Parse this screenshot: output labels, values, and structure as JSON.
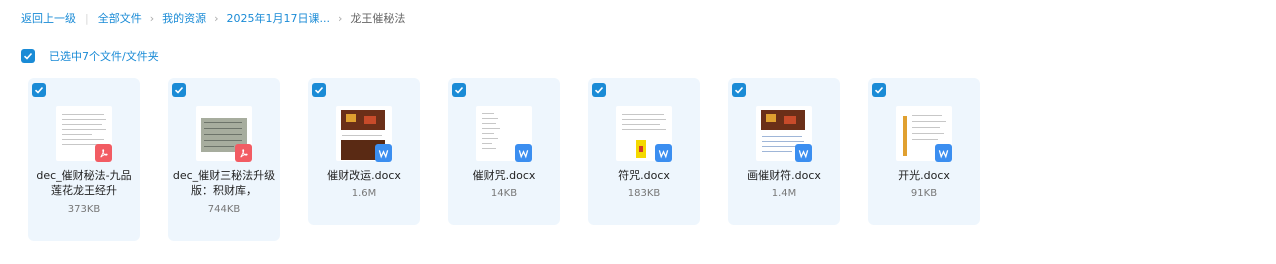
{
  "breadcrumb": {
    "back": "返回上一级",
    "all_files": "全部文件",
    "my_resources": "我的资源",
    "folder_2025": "2025年1月17日课...",
    "current": "龙王催秘法"
  },
  "selection": {
    "label": "已选中7个文件/文件夹"
  },
  "files": [
    {
      "name": "dec_催财秘法-九品莲花龙王经升",
      "size": "373KB",
      "type": "pdf"
    },
    {
      "name": "dec_催财三秘法升级版：积财库，",
      "size": "744KB",
      "type": "pdf"
    },
    {
      "name": "催财改运.docx",
      "size": "1.6M",
      "type": "docx"
    },
    {
      "name": "催财咒.docx",
      "size": "14KB",
      "type": "docx"
    },
    {
      "name": "符咒.docx",
      "size": "183KB",
      "type": "docx"
    },
    {
      "name": "画催财符.docx",
      "size": "1.4M",
      "type": "docx"
    },
    {
      "name": "开光.docx",
      "size": "91KB",
      "type": "docx"
    }
  ],
  "colors": {
    "accent": "#1a8bd6",
    "card_bg": "#eef6fd",
    "pdf_badge": "#f25c63",
    "doc_badge": "#3b8ef0"
  },
  "icons": {
    "checkbox": "check-icon",
    "pdf": "pdf-icon",
    "docx": "word-icon"
  }
}
